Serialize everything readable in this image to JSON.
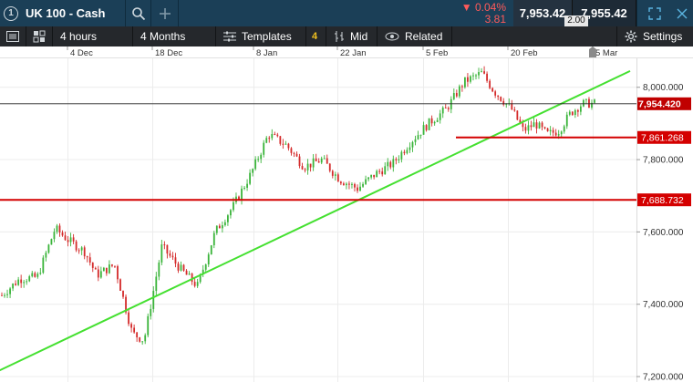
{
  "topbar": {
    "instrument_number": "1",
    "instrument": "UK 100 - Cash",
    "change_pct": "▼ 0.04%",
    "change_abs": "3.81",
    "sell_price": "7,953.42",
    "buy_price": "7,955.42",
    "spread": "2.00"
  },
  "toolbar": {
    "interval": "4 hours",
    "range": "4 Months",
    "templates_label": "Templates",
    "templates_count": "4",
    "price_type": "Mid",
    "related_label": "Related",
    "settings_label": "Settings"
  },
  "colors": {
    "up": "#3ab43a",
    "down": "#d42a2a",
    "trendline": "#44e030",
    "level_line": "#d40000",
    "topbar_bg": "#1b3f57",
    "toolbar_bg": "#25282c"
  },
  "chart_data": {
    "type": "candlestick",
    "x_ticks": [
      "4 Dec",
      "18 Dec",
      "8 Jan",
      "22 Jan",
      "5 Feb",
      "20 Feb",
      "5 Mar"
    ],
    "y_ticks": [
      "8,000.000",
      "7,800.000",
      "7,600.000",
      "7,400.000",
      "7,200.000"
    ],
    "y_tick_values": [
      8000,
      7800,
      7600,
      7400,
      7200
    ],
    "ylim": [
      7185,
      8080
    ],
    "current_price": "7,954.420",
    "current_value": 7954.42,
    "levels": [
      {
        "label": "7,861.268",
        "value": 7861.268
      },
      {
        "label": "7,688.732",
        "value": 7688.732
      }
    ],
    "trendline": {
      "from": [
        -0.09,
        7150
      ],
      "to": [
        1.06,
        8045
      ]
    },
    "anchors": [
      [
        0.0,
        7425
      ],
      [
        0.03,
        7470
      ],
      [
        0.06,
        7475
      ],
      [
        0.09,
        7610
      ],
      [
        0.11,
        7580
      ],
      [
        0.14,
        7545
      ],
      [
        0.16,
        7480
      ],
      [
        0.19,
        7510
      ],
      [
        0.22,
        7320
      ],
      [
        0.24,
        7300
      ],
      [
        0.27,
        7560
      ],
      [
        0.3,
        7500
      ],
      [
        0.33,
        7450
      ],
      [
        0.36,
        7600
      ],
      [
        0.39,
        7670
      ],
      [
        0.42,
        7760
      ],
      [
        0.45,
        7870
      ],
      [
        0.48,
        7840
      ],
      [
        0.51,
        7780
      ],
      [
        0.54,
        7800
      ],
      [
        0.57,
        7745
      ],
      [
        0.6,
        7720
      ],
      [
        0.63,
        7760
      ],
      [
        0.66,
        7790
      ],
      [
        0.69,
        7850
      ],
      [
        0.72,
        7900
      ],
      [
        0.75,
        7940
      ],
      [
        0.78,
        8015
      ],
      [
        0.81,
        8040
      ],
      [
        0.83,
        7990
      ],
      [
        0.86,
        7940
      ],
      [
        0.88,
        7880
      ],
      [
        0.9,
        7900
      ],
      [
        0.92,
        7870
      ],
      [
        0.94,
        7880
      ],
      [
        0.96,
        7930
      ],
      [
        0.98,
        7955
      ],
      [
        1.0,
        7955
      ]
    ]
  }
}
